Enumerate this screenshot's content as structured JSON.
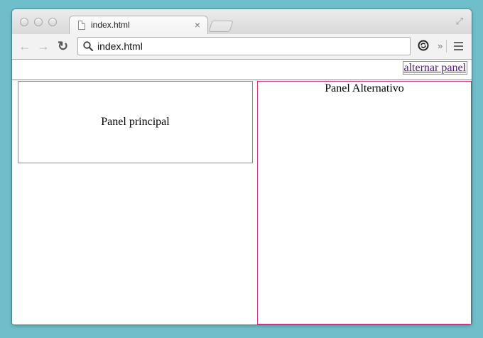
{
  "tab": {
    "title": "index.html",
    "close_glyph": "×"
  },
  "toolbar": {
    "url": "index.html",
    "back_glyph": "←",
    "forward_glyph": "→",
    "reload_glyph": "↻",
    "overflow_glyph": "»"
  },
  "page": {
    "toggle_link": "alternar panel",
    "main_panel": "Panel principal",
    "alt_panel": "Panel Alternativo"
  },
  "colors": {
    "background": "#6fbfcb",
    "alt_panel_border": "#d9357f",
    "link": "#551a8b"
  },
  "icons": [
    "document-icon",
    "close-icon",
    "new-tab-icon",
    "fullscreen-icon",
    "back-icon",
    "forward-icon",
    "reload-icon",
    "search-icon",
    "extension-icon",
    "chevron-right-icon",
    "menu-icon"
  ]
}
